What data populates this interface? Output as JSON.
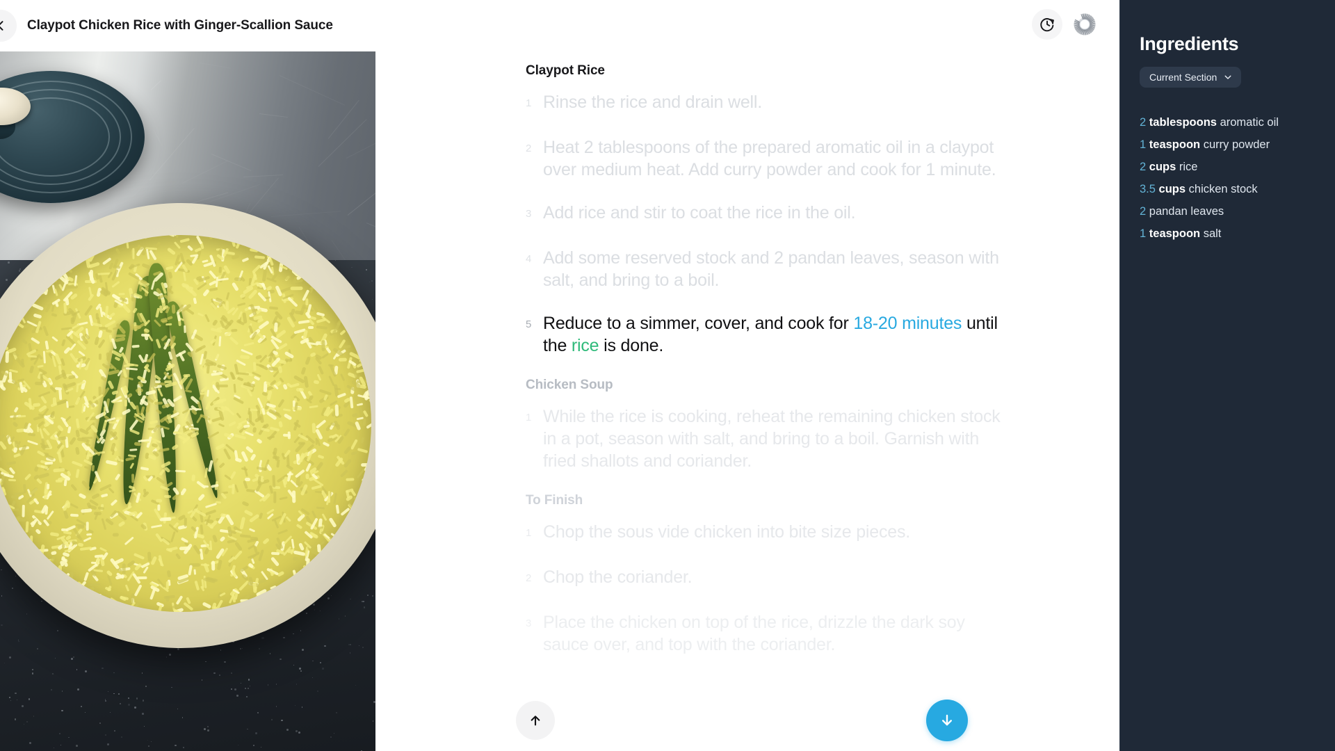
{
  "header": {
    "title": "Claypot Chicken Rice with Ginger-Scallion Sauce",
    "back_icon": "chevron-left-icon",
    "timer_icon": "timer-icon",
    "progress_icon": "radial-progress-icon"
  },
  "hero": {
    "alt": "Claypot of yellow rice with pandan leaves on a stove"
  },
  "sections": [
    {
      "heading": "Claypot Rice",
      "heading_state": "done",
      "steps": [
        {
          "number": "1",
          "state": "done",
          "tokens": [
            {
              "type": "text",
              "text": "Rinse the rice and drain well."
            }
          ]
        },
        {
          "number": "2",
          "state": "done",
          "tokens": [
            {
              "type": "text",
              "text": "Heat 2 tablespoons of the prepared aromatic oil in a claypot over medium heat. Add curry powder and cook for 1 minute."
            }
          ]
        },
        {
          "number": "3",
          "state": "done",
          "tokens": [
            {
              "type": "text",
              "text": "Add rice and stir to coat the rice in the oil."
            }
          ]
        },
        {
          "number": "4",
          "state": "done",
          "tokens": [
            {
              "type": "text",
              "text": "Add some reserved stock and 2 pandan leaves, season with salt, and bring to a boil."
            }
          ]
        },
        {
          "number": "5",
          "state": "active",
          "tokens": [
            {
              "type": "text",
              "text": "Reduce to a simmer, cover, and cook for "
            },
            {
              "type": "timer",
              "text": "18-20 minutes"
            },
            {
              "type": "text",
              "text": " until the "
            },
            {
              "type": "ingredient",
              "text": "rice"
            },
            {
              "type": "text",
              "text": " is done."
            }
          ]
        }
      ]
    },
    {
      "heading": "Chicken Soup",
      "heading_state": "upcoming",
      "steps": [
        {
          "number": "1",
          "state": "upcoming",
          "tokens": [
            {
              "type": "text",
              "text": "While the rice is cooking, reheat the remaining chicken stock in a pot, season with salt, and bring to a boil. Garnish with fried shallots and coriander."
            }
          ]
        }
      ]
    },
    {
      "heading": "To Finish",
      "heading_state": "upcoming2",
      "steps": [
        {
          "number": "1",
          "state": "upcoming2",
          "tokens": [
            {
              "type": "text",
              "text": "Chop the sous vide chicken into bite size pieces."
            }
          ]
        },
        {
          "number": "2",
          "state": "upcoming2",
          "tokens": [
            {
              "type": "text",
              "text": "Chop the coriander."
            }
          ]
        },
        {
          "number": "3",
          "state": "upcoming3",
          "tokens": [
            {
              "type": "text",
              "text": "Place the chicken on top of the rice, drizzle the dark soy sauce over, and top with the coriander."
            }
          ]
        }
      ]
    }
  ],
  "nav": {
    "up_icon": "arrow-up-icon",
    "down_icon": "arrow-down-icon"
  },
  "sidebar": {
    "title": "Ingredients",
    "section_filter_label": "Current Section",
    "section_filter_icon": "chevron-down-icon",
    "ingredients": [
      {
        "qty": "2",
        "unit": "tablespoons",
        "name": "aromatic oil"
      },
      {
        "qty": "1",
        "unit": "teaspoon",
        "name": "curry powder"
      },
      {
        "qty": "2",
        "unit": "cups",
        "name": "rice"
      },
      {
        "qty": "3.5",
        "unit": "cups",
        "name": "chicken stock"
      },
      {
        "qty": "2",
        "unit": "",
        "name": "pandan leaves"
      },
      {
        "qty": "1",
        "unit": "teaspoon",
        "name": "salt"
      }
    ]
  },
  "colors": {
    "accent_blue": "#27a9e1",
    "timer_link": "#28a9e0",
    "ingredient_link": "#2fba7a",
    "sidebar_bg": "#1f2937",
    "qty_blue": "#63b3d6"
  }
}
